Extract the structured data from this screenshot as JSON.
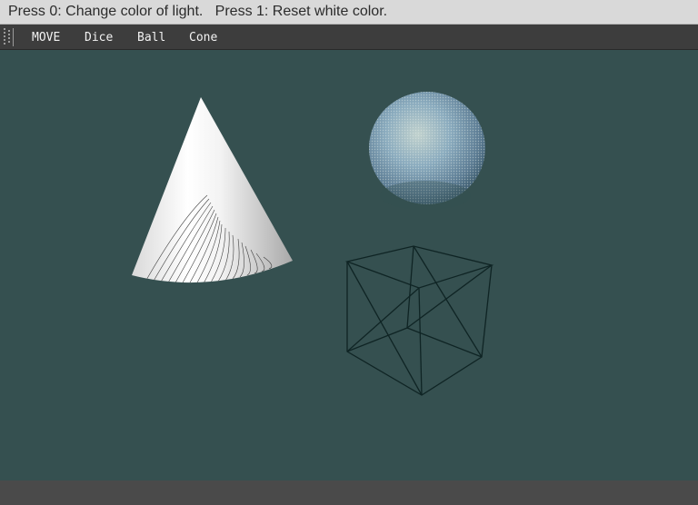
{
  "window": {
    "instructions": "Press 0: Change color of light.   Press 1: Reset white color."
  },
  "menu": {
    "items": [
      {
        "label": "MOVE"
      },
      {
        "label": "Dice"
      },
      {
        "label": "Ball"
      },
      {
        "label": "Cone"
      }
    ]
  },
  "scene": {
    "background_color": "#355050",
    "objects": [
      {
        "name": "cone",
        "render": "shaded",
        "color": "#ececec"
      },
      {
        "name": "ball",
        "render": "dotted-textured",
        "color": "#8fb0c4"
      },
      {
        "name": "dice",
        "render": "wireframe",
        "color": "#0f2424"
      }
    ]
  },
  "icons": {
    "menu_grip": "grip-icon"
  }
}
